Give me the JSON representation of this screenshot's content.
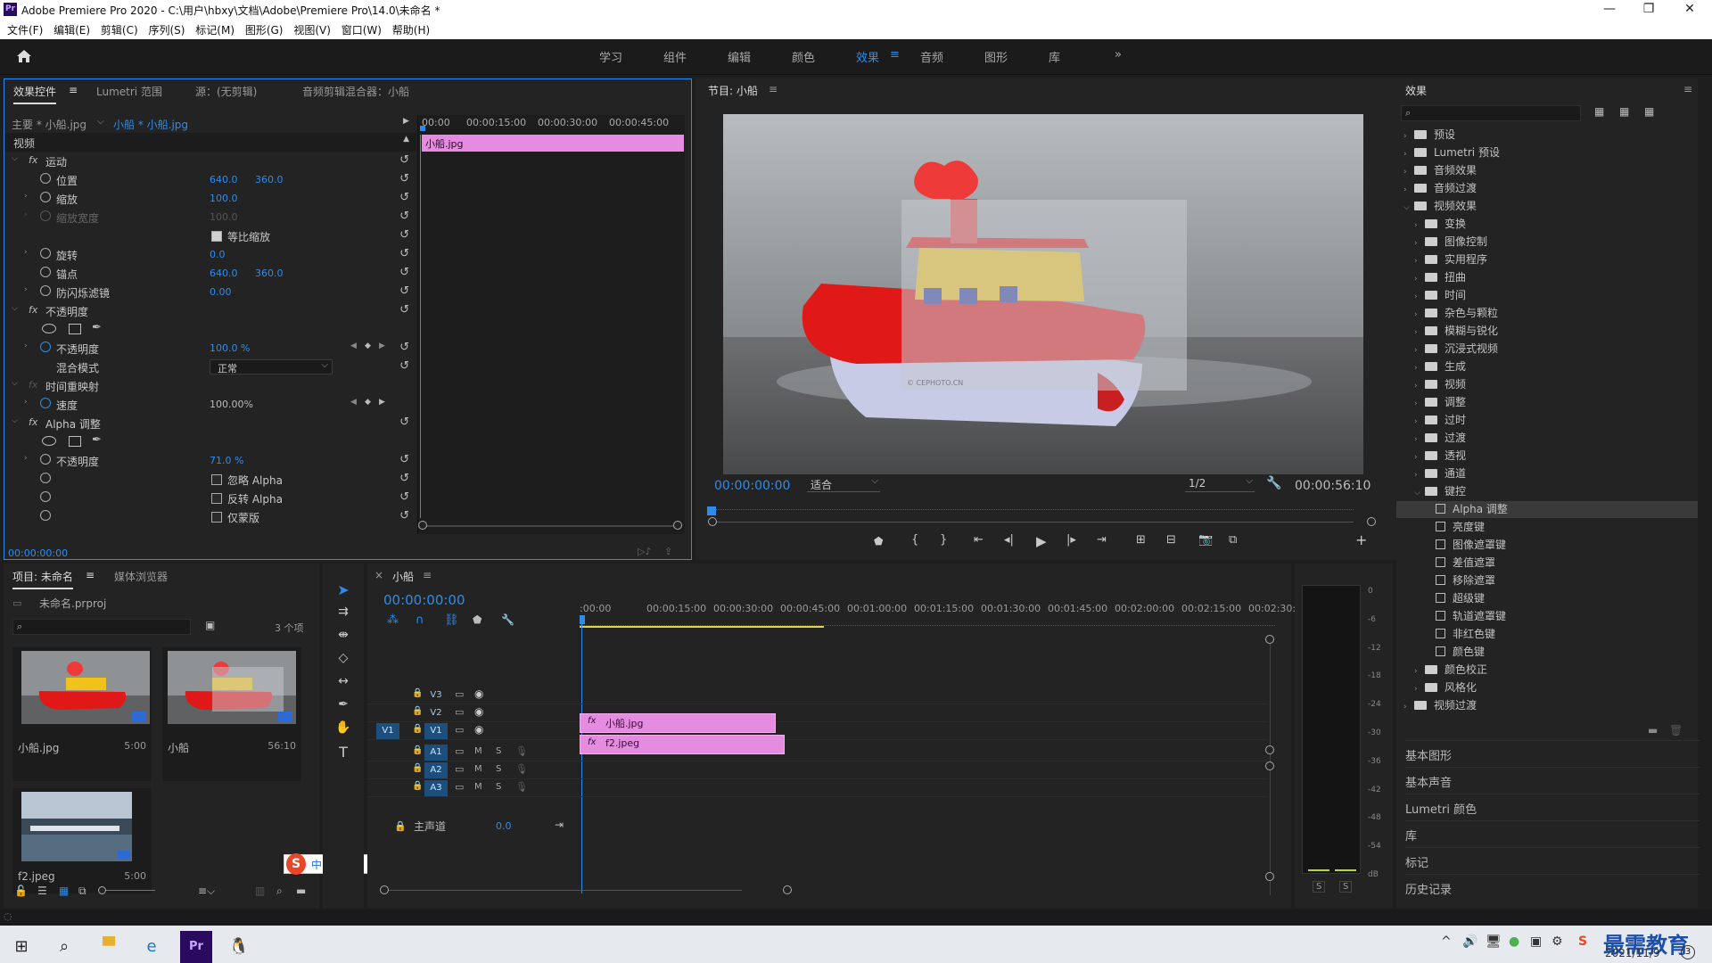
{
  "window": {
    "title": "Adobe Premiere Pro 2020 - C:\\用户\\hbxy\\文档\\Adobe\\Premiere Pro\\14.0\\未命名 *",
    "minimize": "—",
    "maximize": "❐",
    "close": "✕"
  },
  "menu": [
    "文件(F)",
    "编辑(E)",
    "剪辑(C)",
    "序列(S)",
    "标记(M)",
    "图形(G)",
    "视图(V)",
    "窗口(W)",
    "帮助(H)"
  ],
  "workspaces": {
    "items": [
      "学习",
      "组件",
      "编辑",
      "颜色",
      "效果",
      "音频",
      "图形",
      "库"
    ],
    "active": "效果",
    "more": "»"
  },
  "effect_controls": {
    "tabs": [
      "效果控件",
      "Lumetri 范围",
      "源：(无剪辑)",
      "音频剪辑混合器：小船"
    ],
    "master": "主要 * 小船.jpg",
    "clip": "小船 * 小船.jpg",
    "section_video": "视频",
    "ruler": [
      "00:00",
      "00:00:15:00",
      "00:00:30:00",
      "00:00:45:00"
    ],
    "clip_bar": "小船.jpg",
    "motion": "运动",
    "position": {
      "label": "位置",
      "x": "640.0",
      "y": "360.0"
    },
    "scale": {
      "label": "缩放",
      "value": "100.0"
    },
    "scale_width": {
      "label": "缩放宽度",
      "value": "100.0"
    },
    "uniform_scale": "等比缩放",
    "rotation": {
      "label": "旋转",
      "value": "0.0"
    },
    "anchor": {
      "label": "锚点",
      "x": "640.0",
      "y": "360.0"
    },
    "flicker": {
      "label": "防闪烁滤镜",
      "value": "0.00"
    },
    "opacity": "不透明度",
    "opacity_value": {
      "label": "不透明度",
      "value": "100.0 %"
    },
    "blend_mode": {
      "label": "混合模式",
      "value": "正常"
    },
    "time_remap": "时间重映射",
    "speed": {
      "label": "速度",
      "value": "100.00%"
    },
    "alpha_adjust": "Alpha 调整",
    "alpha_opacity": {
      "label": "不透明度",
      "value": "71.0 %"
    },
    "ignore_alpha": "忽略 Alpha",
    "invert_alpha": "反转 Alpha",
    "mask_only": "仅蒙版",
    "timecode": "00:00:00:00"
  },
  "program": {
    "title": "节目: 小船",
    "timecode": "00:00:00:00",
    "fit": "适合",
    "resolution": "1/2",
    "duration": "00:00:56:10",
    "watermark": "© CEPHOTO.CN"
  },
  "effects_panel": {
    "title": "效果",
    "items": [
      {
        "t": "folder",
        "d": 0,
        "e": false,
        "label": "预设"
      },
      {
        "t": "folder",
        "d": 0,
        "e": false,
        "label": "Lumetri 预设"
      },
      {
        "t": "folder",
        "d": 0,
        "e": false,
        "label": "音频效果"
      },
      {
        "t": "folder",
        "d": 0,
        "e": false,
        "label": "音频过渡"
      },
      {
        "t": "folder",
        "d": 0,
        "e": true,
        "label": "视频效果"
      },
      {
        "t": "folder",
        "d": 1,
        "e": false,
        "label": "变换"
      },
      {
        "t": "folder",
        "d": 1,
        "e": false,
        "label": "图像控制"
      },
      {
        "t": "folder",
        "d": 1,
        "e": false,
        "label": "实用程序"
      },
      {
        "t": "folder",
        "d": 1,
        "e": false,
        "label": "扭曲"
      },
      {
        "t": "folder",
        "d": 1,
        "e": false,
        "label": "时间"
      },
      {
        "t": "folder",
        "d": 1,
        "e": false,
        "label": "杂色与颗粒"
      },
      {
        "t": "folder",
        "d": 1,
        "e": false,
        "label": "模糊与锐化"
      },
      {
        "t": "folder",
        "d": 1,
        "e": false,
        "label": "沉浸式视频"
      },
      {
        "t": "folder",
        "d": 1,
        "e": false,
        "label": "生成"
      },
      {
        "t": "folder",
        "d": 1,
        "e": false,
        "label": "视频"
      },
      {
        "t": "folder",
        "d": 1,
        "e": false,
        "label": "调整"
      },
      {
        "t": "folder",
        "d": 1,
        "e": false,
        "label": "过时"
      },
      {
        "t": "folder",
        "d": 1,
        "e": false,
        "label": "过渡"
      },
      {
        "t": "folder",
        "d": 1,
        "e": false,
        "label": "透视"
      },
      {
        "t": "folder",
        "d": 1,
        "e": false,
        "label": "通道"
      },
      {
        "t": "folder",
        "d": 1,
        "e": true,
        "label": "键控"
      },
      {
        "t": "fx",
        "d": 2,
        "label": "Alpha 调整",
        "sel": true
      },
      {
        "t": "fx",
        "d": 2,
        "label": "亮度键"
      },
      {
        "t": "fx",
        "d": 2,
        "label": "图像遮罩键"
      },
      {
        "t": "fx",
        "d": 2,
        "label": "差值遮罩"
      },
      {
        "t": "fx",
        "d": 2,
        "label": "移除遮罩"
      },
      {
        "t": "fx",
        "d": 2,
        "label": "超级键"
      },
      {
        "t": "fx",
        "d": 2,
        "label": "轨道遮罩键"
      },
      {
        "t": "fx",
        "d": 2,
        "label": "非红色键"
      },
      {
        "t": "fx",
        "d": 2,
        "label": "颜色键"
      },
      {
        "t": "folder",
        "d": 1,
        "e": false,
        "label": "颜色校正"
      },
      {
        "t": "folder",
        "d": 1,
        "e": false,
        "label": "风格化"
      },
      {
        "t": "folder",
        "d": 0,
        "e": false,
        "label": "视频过渡"
      }
    ],
    "side_panels": [
      "基本图形",
      "基本声音",
      "Lumetri 颜色",
      "库",
      "标记",
      "历史记录"
    ]
  },
  "project": {
    "tabs": [
      "项目: 未命名",
      "媒体浏览器"
    ],
    "file": "未命名.prproj",
    "count": "3 个项",
    "items": [
      {
        "name": "小船.jpg",
        "dur": "5:00"
      },
      {
        "name": "小船",
        "dur": "56:10"
      },
      {
        "name": "f2.jpeg",
        "dur": "5:00"
      }
    ]
  },
  "timeline": {
    "tab": "小船",
    "timecode": "00:00:00:00",
    "ruler": [
      ":00:00",
      "00:00:15:00",
      "00:00:30:00",
      "00:00:45:00",
      "00:01:00:00",
      "00:01:15:00",
      "00:01:30:00",
      "00:01:45:00",
      "00:02:00:00",
      "00:02:15:00",
      "00:02:30:0"
    ],
    "tracks": [
      "V3",
      "V2",
      "V1",
      "A1",
      "A2",
      "A3"
    ],
    "source_v1": "V1",
    "master": "主声道",
    "master_val": "0.0",
    "clip_v2": "小船.jpg",
    "clip_v1": "f2.jpeg",
    "m": "M",
    "s": "S"
  },
  "meter": {
    "ticks": [
      "0",
      "-6",
      "-12",
      "-18",
      "-24",
      "-30",
      "-36",
      "-42",
      "-48",
      "-54",
      "dB"
    ],
    "s": "S"
  },
  "ime": {
    "items": [
      "中",
      "°,",
      "☺",
      "🎤",
      "⌨",
      "👤",
      "👕",
      "▦"
    ]
  },
  "taskbar": {
    "date": "2021/11/9",
    "watermark": "最需教育",
    "badge": "3"
  }
}
